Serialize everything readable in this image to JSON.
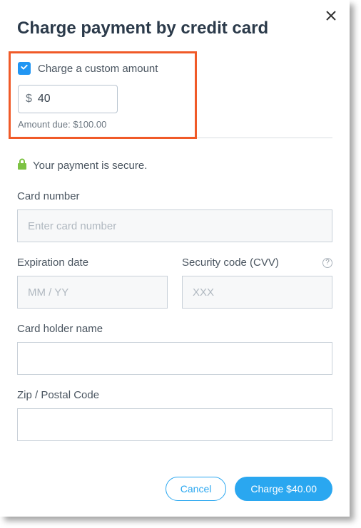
{
  "title": "Charge payment by credit card",
  "custom_amount": {
    "checkbox_label": "Charge a custom amount",
    "currency_symbol": "$",
    "value": "40",
    "amount_due_text": "Amount due: $100.00"
  },
  "secure_text": "Your payment is secure.",
  "fields": {
    "card_number": {
      "label": "Card number",
      "placeholder": "Enter card number"
    },
    "expiration": {
      "label": "Expiration date",
      "placeholder": "MM / YY"
    },
    "cvv": {
      "label": "Security code (CVV)",
      "placeholder": "XXX"
    },
    "holder": {
      "label": "Card holder name"
    },
    "zip": {
      "label": "Zip / Postal Code"
    }
  },
  "buttons": {
    "cancel": "Cancel",
    "charge": "Charge $40.00"
  },
  "help_icon_text": "?"
}
